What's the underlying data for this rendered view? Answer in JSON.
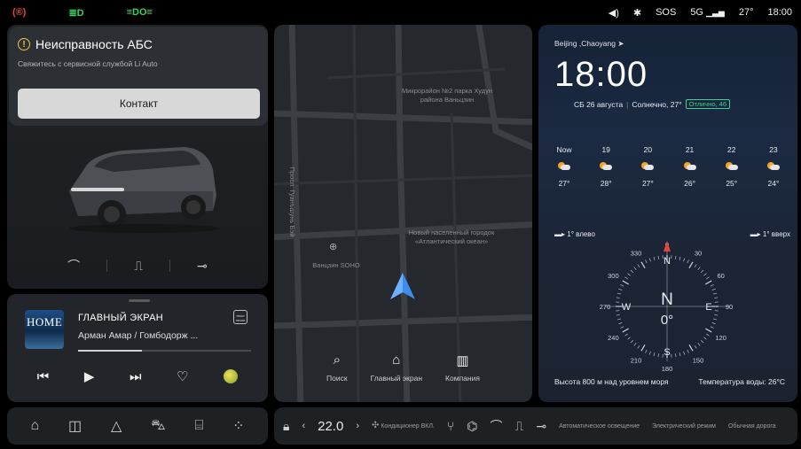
{
  "status_bar": {
    "left_icons": [
      "parking-brake-icon",
      "low-beam-icon",
      "position-lights-icon"
    ],
    "sos_label": "SOS",
    "network_label": "5G",
    "temperature": "27°",
    "time": "18:00",
    "colors": {
      "brake": "#e0463b",
      "lights": "#37d25c"
    }
  },
  "vehicle_card": {
    "alert_title": "Неисправность АБС",
    "alert_subtitle": "Свяжитесь с сервисной службой Li Auto",
    "contact_button": "Контакт",
    "controls": [
      "wiper-icon",
      "seat-heat-icon",
      "lamp-icon"
    ]
  },
  "media": {
    "album_art_text": "HOME",
    "track_title": "ГЛАВНЫЙ ЭКРАН",
    "artist": "Арман Амар / Гомбодорж ...",
    "lyrics_icon_text": "текст песни",
    "progress": 0.37,
    "controls": [
      "previous-icon",
      "play-icon",
      "next-icon",
      "heart-icon",
      "app-coin-icon"
    ]
  },
  "map": {
    "labels": {
      "park": "Микрорайон №2 парка Худун района Ваньцзин",
      "street": "Просп. Гуанъшунь Бэй",
      "soho": "Ванцзин SOHO",
      "village": "Новый населенный городок «Атлантический океан»"
    },
    "actions": [
      {
        "icon": "search-icon",
        "label": "Поиск"
      },
      {
        "icon": "home-icon",
        "label": "Главный экран"
      },
      {
        "icon": "company-icon",
        "label": "Компания"
      }
    ]
  },
  "weather": {
    "location": "Beijing ,Chaoyang",
    "time": "18:00",
    "date": "СБ 26 августа",
    "condition": "Солнечно, 27°",
    "air_quality": "Отлично, 46",
    "forecast": [
      {
        "hour": "Now",
        "temp": "27°"
      },
      {
        "hour": "19",
        "temp": "28°"
      },
      {
        "hour": "20",
        "temp": "27°"
      },
      {
        "hour": "21",
        "temp": "26°"
      },
      {
        "hour": "22",
        "temp": "25°"
      },
      {
        "hour": "23",
        "temp": "24°"
      }
    ],
    "left_tilt": "1° влево",
    "right_tilt": "1° вверх",
    "compass": {
      "direction": "N",
      "heading": "0°",
      "degree_marks": [
        "0",
        "30",
        "60",
        "90",
        "120",
        "150",
        "180",
        "210",
        "240",
        "270",
        "300",
        "330"
      ],
      "cardinals": {
        "n": "N",
        "e": "E",
        "s": "S",
        "w": "W"
      }
    },
    "altitude": "Высота 800 м над уровнем моря",
    "water_temp": "Температура воды: 26°C"
  },
  "dock": {
    "icons": [
      "home-icon",
      "phone-screen-icon",
      "navigation-icon",
      "car-icon",
      "car-control-icon",
      "apps-icon"
    ]
  },
  "climate": {
    "lock_icon": "lock-icon",
    "temperature": "22.0",
    "ac_label": "Кондиционер ВКЛ.",
    "auto_lights": "Автоматическое освещение",
    "electric_mode": "Электрический режим",
    "normal_road": "Обычная дорога"
  }
}
